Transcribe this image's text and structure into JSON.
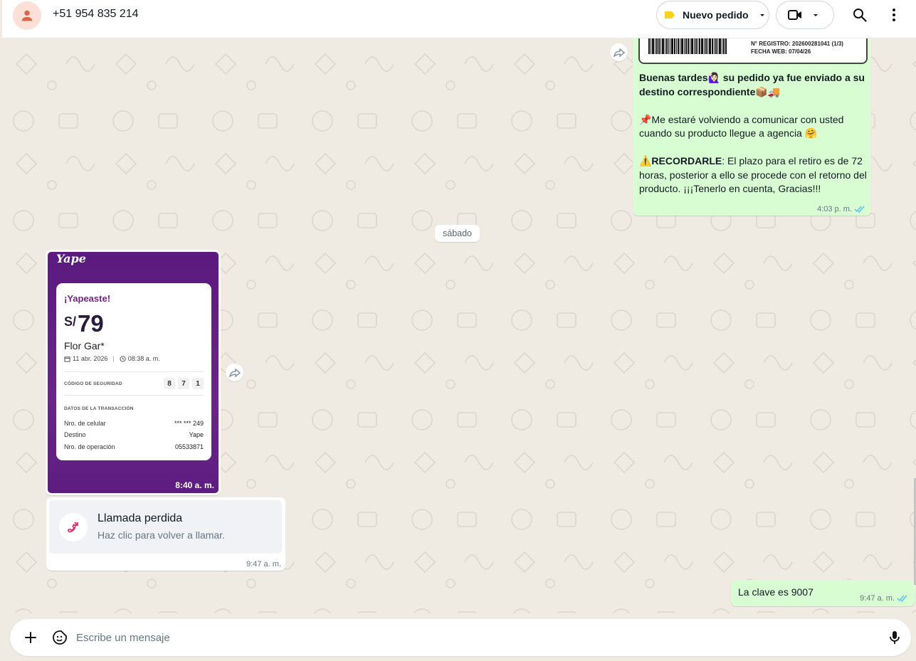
{
  "header": {
    "contact_name": "+51 954 835 214",
    "tag_label": "Nuevo pedido",
    "tag_color": "#f7d21e",
    "icons": [
      "person-icon",
      "label-tag-icon",
      "chevron-down-icon",
      "video-icon",
      "search-icon",
      "more-vertical-icon"
    ]
  },
  "messages": {
    "outgoing_1": {
      "label_image": {
        "registro": "N° REGISTRO: 202600281041 (1/3)",
        "fecha_web": "FECHA WEB: 07/04/26"
      },
      "line1_bold": "Buenas tardes🙋🏻‍♀️ su pedido ya fue enviado a su destino correspondiente📦🚚",
      "line2": "📌Me estaré volviendo a comunicar con usted cuando su producto llegue a agencia 🤗",
      "line3_bold": "⚠️RECORDARLE",
      "line3_rest": ": El plazo para el retiro es de 72 horas, posterior a ello se procede con el retorno del producto. ¡¡¡Tenerlo en cuenta, Gracias!!!",
      "time": "4:03 p. m."
    },
    "date_separator": "sábado",
    "yape_receipt": {
      "logo": "Yape",
      "title": "¡Yapeaste!",
      "currency": "S/",
      "amount": "79",
      "recipient": "Flor Gar*",
      "date": "11 abr. 2026",
      "hour": "08:38 a. m.",
      "security_label": "CÓDIGO DE SEGURIDAD",
      "security_codes": [
        "8",
        "7",
        "1"
      ],
      "transaction_label": "DATOS DE LA TRANSACCIÓN",
      "rows": [
        {
          "label": "Nro. de celular",
          "value": "*** *** 249"
        },
        {
          "label": "Destino",
          "value": "Yape"
        },
        {
          "label": "Nro. de operación",
          "value": "05533871"
        }
      ],
      "time": "8:40 a. m."
    },
    "missed_call": {
      "title": "Llamada perdida",
      "subtitle": "Haz clic para volver a llamar.",
      "time": "9:47 a. m."
    },
    "outgoing_last": {
      "text": "La clave es 9007",
      "time": "9:47 a. m."
    }
  },
  "composer": {
    "placeholder": "Escribe un mensaje",
    "icons": [
      "plus-icon",
      "sticker-icon",
      "microphone-icon"
    ]
  },
  "colors": {
    "outgoing_bubble": "#d9fdd3",
    "read_ticks": "#53bdeb",
    "yape_purple": "#6b2589"
  }
}
